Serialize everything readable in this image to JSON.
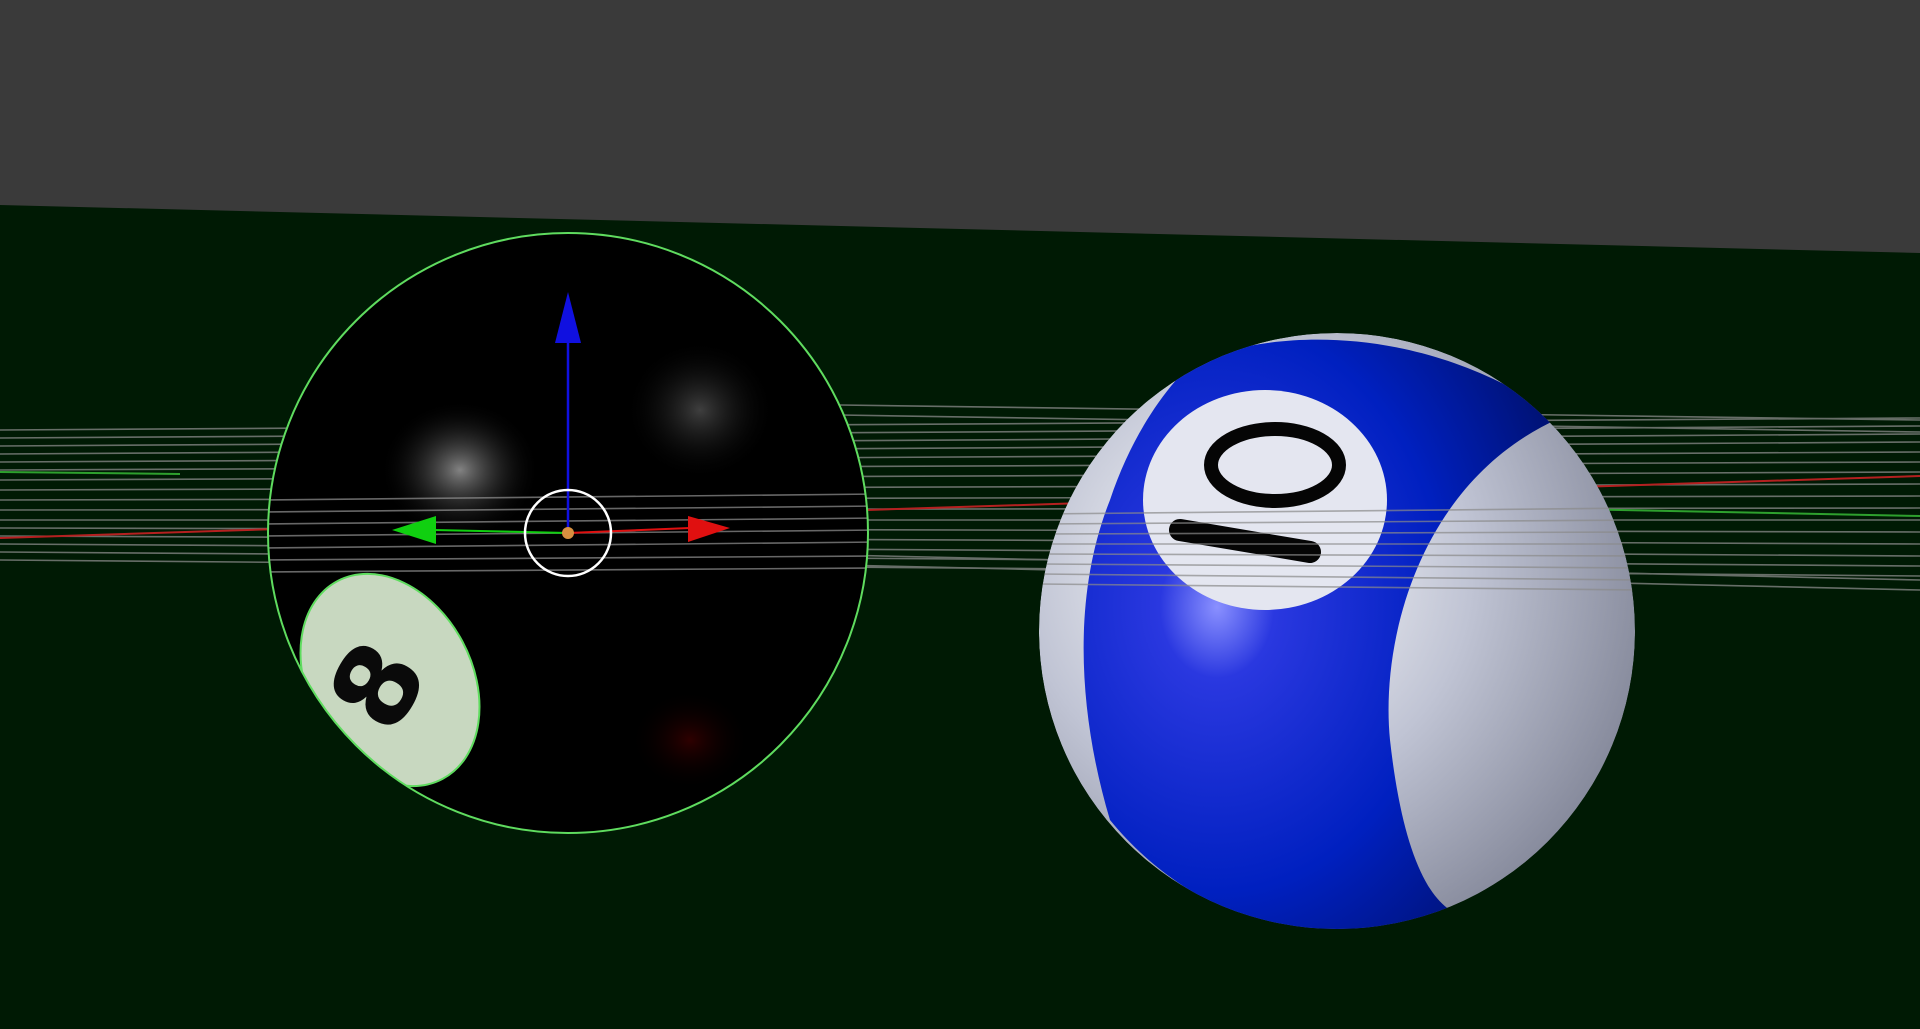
{
  "scene": {
    "background_color": "#3a3a3a",
    "floor_color": "#001a04",
    "grid_line_color": "#8a8a8a",
    "axis_x_color": "#b52020",
    "axis_y_color": "#2ea02e",
    "selection_outline_color": "#5fdc5f"
  },
  "objects": {
    "eight_ball": {
      "number": "8",
      "body_color": "#000000",
      "selected": true
    },
    "ten_ball": {
      "number": "10",
      "stripe_color": "#0022c8",
      "body_color": "#c8ccdc"
    }
  },
  "gizmo": {
    "x_arrow_color": "#e01010",
    "y_arrow_color": "#10d010",
    "z_arrow_color": "#1010e0",
    "center_ring_color": "#ffffff",
    "origin_color": "#d89040"
  }
}
